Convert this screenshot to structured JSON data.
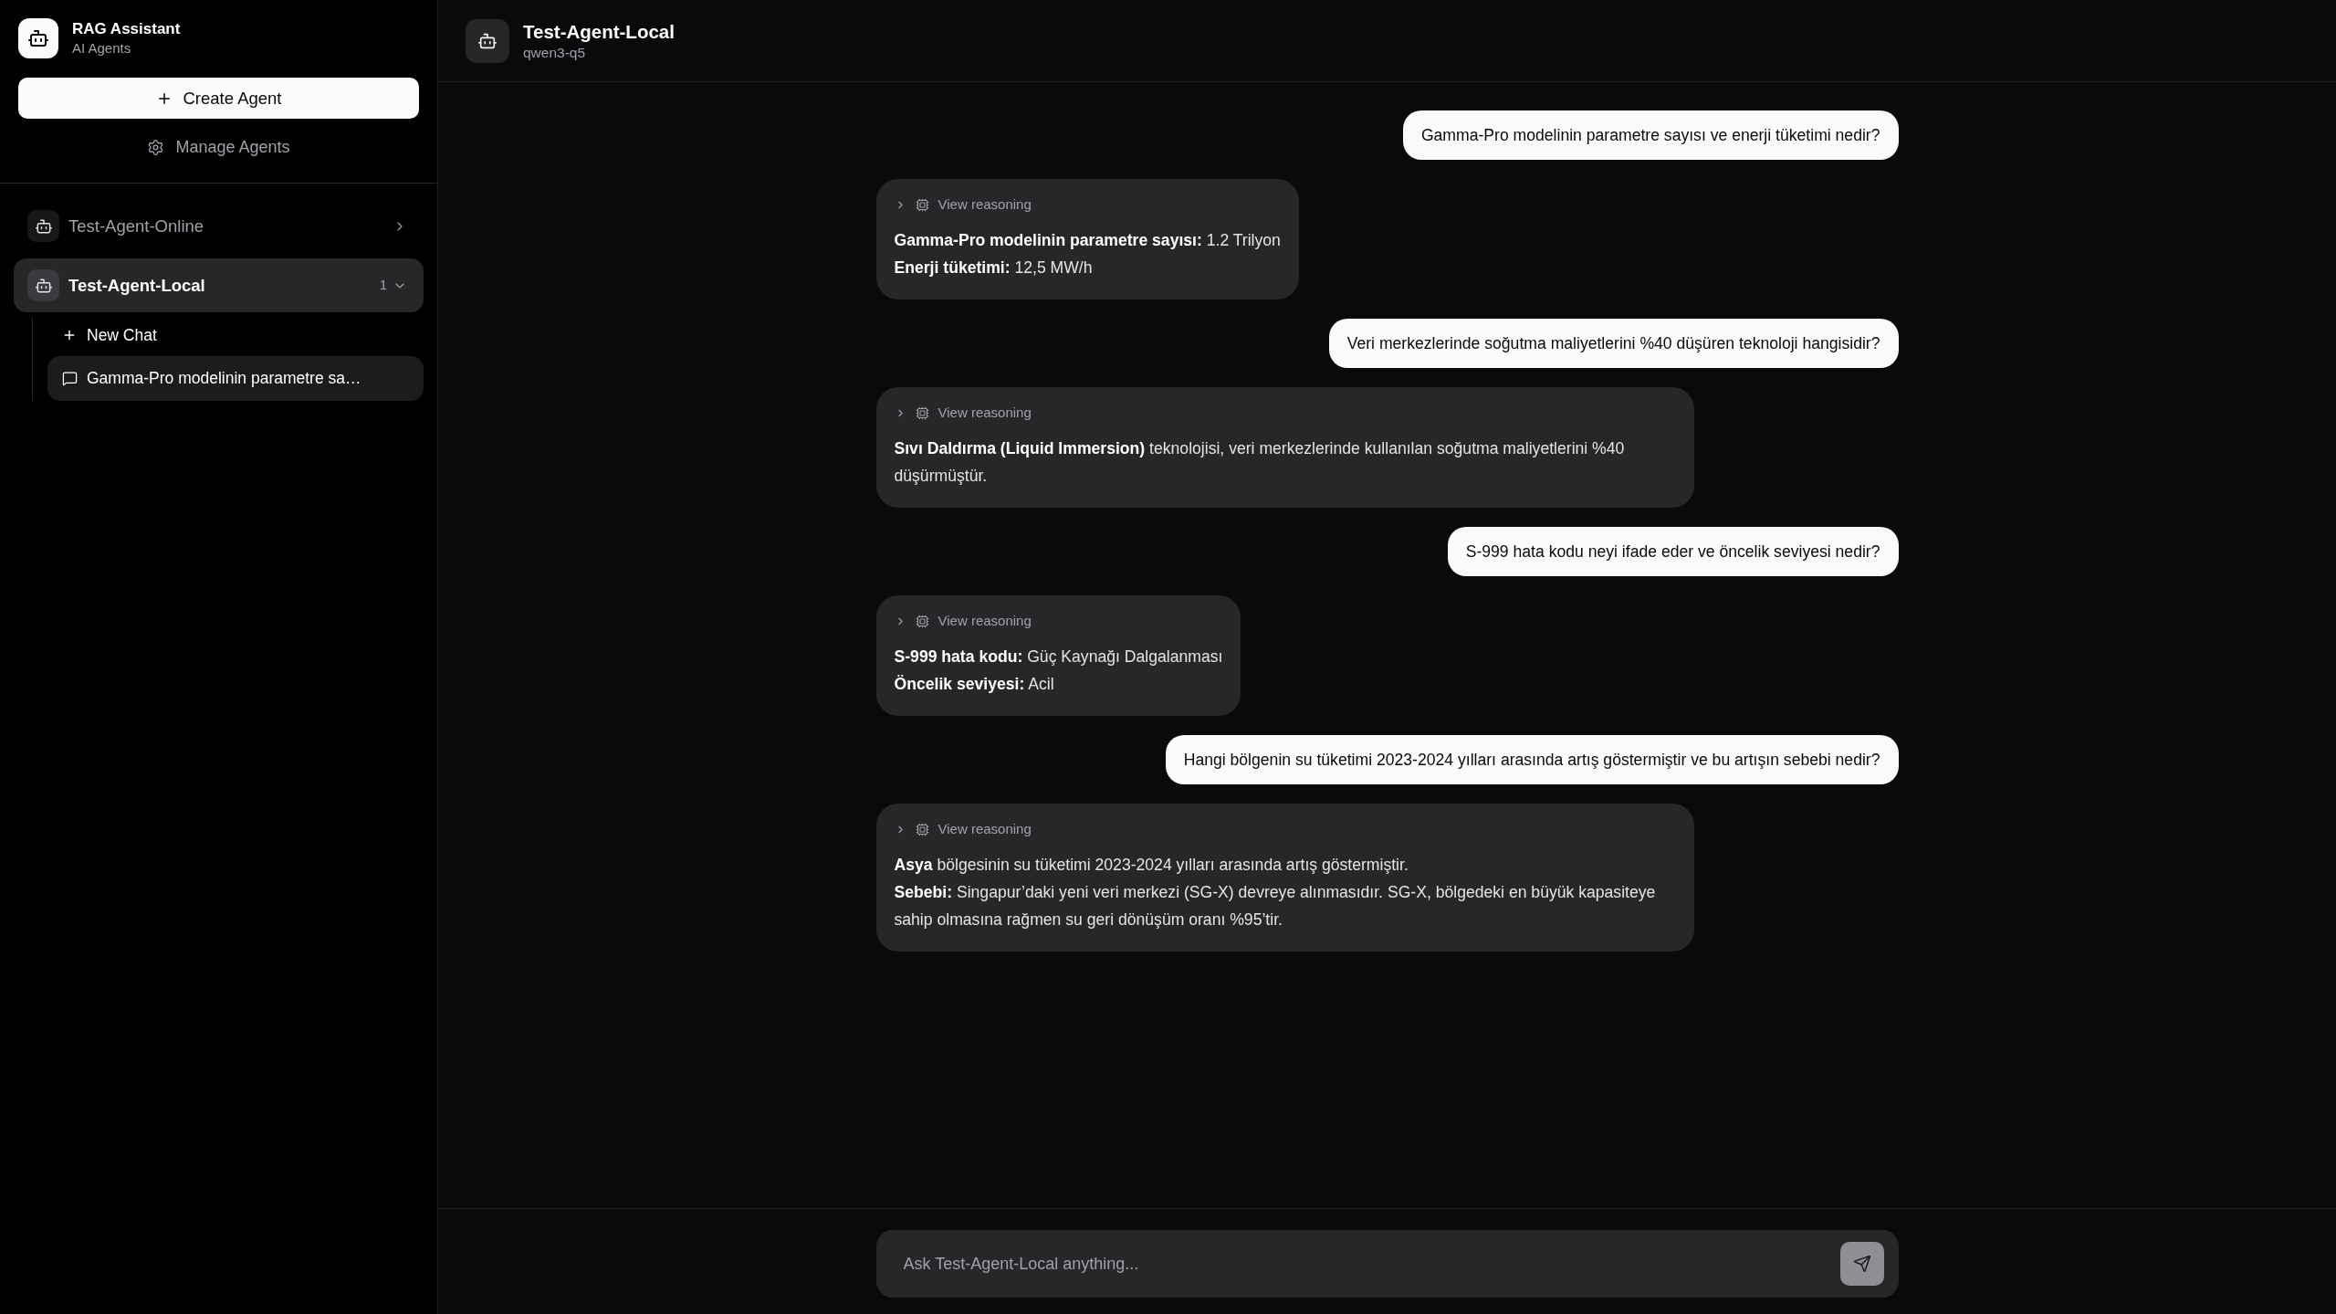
{
  "sidebar": {
    "brand": {
      "title": "RAG Assistant",
      "subtitle": "AI Agents"
    },
    "create_button": "Create Agent",
    "manage_link": "Manage Agents",
    "agents": [
      {
        "name": "Test-Agent-Online",
        "selected": false,
        "expanded": false
      },
      {
        "name": "Test-Agent-Local",
        "selected": true,
        "expanded": true,
        "count": "1",
        "new_chat": "New Chat",
        "chats": [
          {
            "title": "Gamma-Pro modelinin parametre sa…",
            "selected": true
          }
        ]
      }
    ]
  },
  "header": {
    "title": "Test-Agent-Local",
    "subtitle": "qwen3-q5"
  },
  "messages": [
    {
      "kind": "user",
      "text": "Gamma-Pro modelinin parametre sayısı ve enerji tüketimi nedir?"
    },
    {
      "kind": "assistant",
      "reasoning": {
        "label": "View reasoning",
        "expanded": false
      },
      "lines": [
        "**Gamma-Pro modelinin parametre sayısı:** 1.2 Trilyon",
        "**Enerji tüketimi:** 12,5 MW/h"
      ]
    },
    {
      "kind": "user",
      "text": "Veri merkezlerinde soğutma maliyetlerini %40 düşüren teknoloji hangisidir?"
    },
    {
      "kind": "assistant",
      "reasoning": {
        "label": "View reasoning",
        "expanded": false
      },
      "lines": [
        "**Sıvı Daldırma (Liquid Immersion)** teknolojisi, veri merkezlerinde kullanılan soğutma maliyetlerini %40 düşürmüştür."
      ]
    },
    {
      "kind": "user",
      "text": "S-999 hata kodu neyi ifade eder ve öncelik seviyesi nedir?"
    },
    {
      "kind": "assistant",
      "reasoning": {
        "label": "View reasoning",
        "expanded": false
      },
      "lines": [
        "**S-999 hata kodu:** Güç Kaynağı Dalgalanması",
        "**Öncelik seviyesi:** Acil"
      ]
    },
    {
      "kind": "user",
      "text": "Hangi bölgenin su tüketimi 2023-2024 yılları arasında artış göstermiştir ve bu artışın sebebi nedir?"
    },
    {
      "kind": "assistant",
      "reasoning": {
        "label": "View reasoning",
        "expanded": false
      },
      "lines": [
        "**Asya** bölgesinin su tüketimi 2023-2024 yılları arasında artış göstermiştir.",
        "**Sebebi:** Singapur’daki yeni veri merkezi (SG-X) devreye alınmasıdır. SG-X, bölgedeki en büyük kapasiteye sahip olmasına rağmen su geri dönüşüm oranı %95’tir."
      ]
    }
  ],
  "composer": {
    "placeholder": "Ask Test-Agent-Local anything...",
    "send_disabled": true
  }
}
